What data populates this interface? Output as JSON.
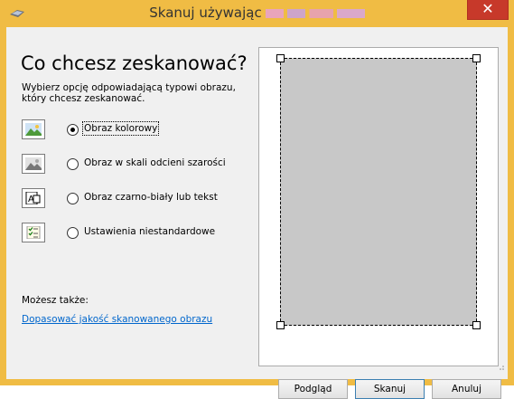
{
  "window": {
    "title": "Skanuj używając",
    "close_glyph": "✕",
    "accent_color": "#f0bc44"
  },
  "main": {
    "heading": "Co chcesz zeskanować?",
    "description": "Wybierz opcję odpowiadającą typowi obrazu, który chcesz zeskanować.",
    "options": [
      {
        "label": "Obraz kolorowy",
        "icon": "color-picture-icon",
        "selected": true
      },
      {
        "label": "Obraz w skali odcieni szarości",
        "icon": "grayscale-picture-icon",
        "selected": false
      },
      {
        "label": "Obraz czarno-biały lub tekst",
        "icon": "black-white-text-icon",
        "selected": false
      },
      {
        "label": "Ustawienia niestandardowe",
        "icon": "custom-settings-icon",
        "selected": false
      }
    ],
    "also_label": "Możesz także:",
    "adjust_link": "Dopasować jakość skanowanego obrazu"
  },
  "buttons": {
    "preview": "Podgląd",
    "scan": "Skanuj",
    "cancel": "Anuluj"
  }
}
